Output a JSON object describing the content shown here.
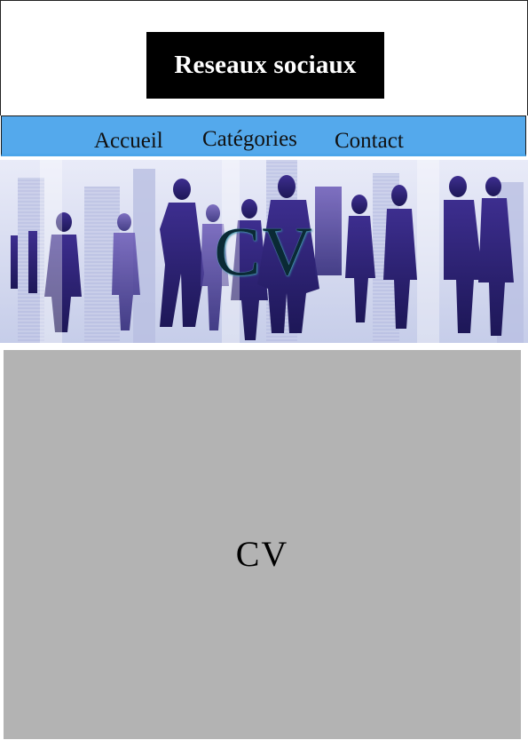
{
  "header": {
    "logo_text": "Reseaux sociaux"
  },
  "nav": {
    "items": [
      {
        "label": "Accueil"
      },
      {
        "label": "Catégories"
      },
      {
        "label": "Contact"
      }
    ]
  },
  "banner": {
    "title": "CV"
  },
  "main": {
    "title": "CV"
  },
  "colors": {
    "nav_bg": "#54a9ec",
    "logo_bg": "#000000",
    "content_bg": "#b3b3b3"
  }
}
